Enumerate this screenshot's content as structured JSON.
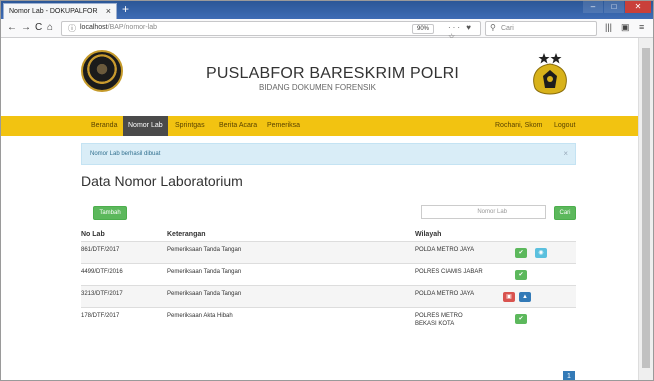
{
  "browser": {
    "tab_title": "Nomor Lab - DOKUPALFOR",
    "tab_close": "×",
    "new_tab": "+",
    "url_host": "localhost",
    "url_path": "/BAP/nomor-lab",
    "zoom": "90%",
    "url_actions": "··· ♥ ☆",
    "search_placeholder": "Cari",
    "nav_back": "←",
    "nav_forward": "→",
    "nav_reload": "C",
    "nav_home": "⌂",
    "window_minimize": "–",
    "window_maximize": "□",
    "window_close": "✕",
    "library_icon": "|||",
    "sidebar_icon": "▣",
    "menu_icon": "≡"
  },
  "header": {
    "title": "PUSLABFOR BARESKRIM POLRI",
    "subtitle": "BIDANG DOKUMEN FORENSIK",
    "left_logo_text": "PUSLABFOR POLRI"
  },
  "menu": {
    "items": [
      {
        "label": "Beranda"
      },
      {
        "label": "Nomor Lab",
        "active": true
      },
      {
        "label": "Sprintgas"
      },
      {
        "label": "Berita Acara"
      },
      {
        "label": "Pemeriksa"
      }
    ],
    "user": "Rochani, Skom",
    "logout": "Logout"
  },
  "alert": {
    "message": "Nomor Lab berhasil dibuat",
    "close": "×"
  },
  "page": {
    "title": "Data Nomor Laboratorium",
    "add_button": "Tambah",
    "search_placeholder": "Nomor Lab",
    "search_button": "Cari"
  },
  "table": {
    "columns": [
      "No Lab",
      "Keterangan",
      "Wilayah"
    ],
    "rows": [
      {
        "no_lab": "861/DTF/2017",
        "keterangan": "Pemeriksaan Tanda Tangan",
        "wilayah": "POLDA METRO JAYA",
        "wilayah2": "",
        "actions": [
          "check",
          "eye"
        ]
      },
      {
        "no_lab": "4499/DTF/2016",
        "keterangan": "Pemeriksaan Tanda Tangan",
        "wilayah": "POLRES CIAMIS JABAR",
        "wilayah2": "",
        "actions": [
          "check"
        ]
      },
      {
        "no_lab": "3213/DTF/2017",
        "keterangan": "Pemeriksaan Tanda Tangan",
        "wilayah": "POLDA METRO JAYA",
        "wilayah2": "",
        "actions": [
          "delete",
          "edit"
        ]
      },
      {
        "no_lab": "178/DTF/2017",
        "keterangan": "Pemeriksaan Akta Hibah",
        "wilayah": "POLRES METRO",
        "wilayah2": "BEKASI KOTA",
        "actions": [
          "check"
        ]
      }
    ]
  },
  "pagination": {
    "current": "1"
  },
  "icons": {
    "check": "✔",
    "eye": "◉",
    "delete": "🗑",
    "edit": "▲"
  },
  "colors": {
    "menu_bg": "#f2c311",
    "alert_bg": "#d9edf7",
    "success": "#5cb85c",
    "info": "#5bc0de",
    "danger": "#d9534f",
    "primary": "#337ab7"
  }
}
